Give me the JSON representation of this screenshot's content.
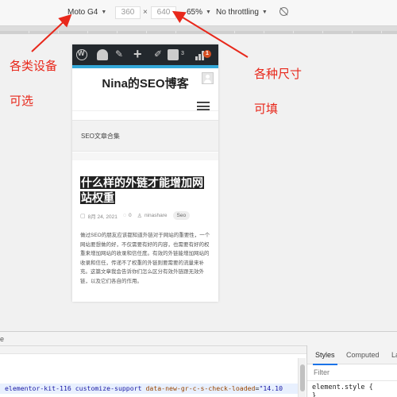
{
  "device_toolbar": {
    "device": "Moto G4",
    "width": "360",
    "times": "×",
    "height": "640",
    "zoom": "65%",
    "throttling": "No throttling",
    "dropdown_glyph": "▼",
    "rotate_icon": "rotate-icon"
  },
  "site": {
    "admin_bar": {
      "yoast_count": "3",
      "notification_count": "1",
      "icons": [
        "wordpress-icon",
        "dashboard-icon",
        "customize-icon",
        "add-new-icon",
        "edit-icon",
        "yoast-icon",
        "stats-icon"
      ]
    },
    "title": "Nina的SEO博客",
    "category_label": "SEO文章合集",
    "post": {
      "title": "什么样的外链才能增加网站权重",
      "date": "8月 24, 2021",
      "comments": "0",
      "author": "ninashare",
      "tag": "Seo",
      "excerpt": "做过SEO的朋友应该都知道外链对于网站的重要性，一个网站要想做的好，不仅需要有好的内容，也需要有好的权重来增加网站的收录和信任度。有效的外链能增加网站的收录和信任，传递不了权重的外链则要需要的流量来补充。这篇文章我会告诉你们怎么区分有效外链跟无效外链，以及它们各自的作用。"
    }
  },
  "annotations": {
    "left_top": "各类设备",
    "left_bottom": "可选",
    "right_top": "各种尺寸",
    "right_bottom": "可填",
    "color": "#e8281b"
  },
  "devtools": {
    "left_tab_label": "e",
    "code": {
      "class_value": "elementor-kit-116 customize-support",
      "attr_name": "data-new-gr-c-s-check-loaded",
      "attr_value": "\"14.10"
    },
    "tabs": [
      "Styles",
      "Computed",
      "La"
    ],
    "filter_placeholder": "Filter",
    "style_rule": "element.style {",
    "style_close": "}"
  }
}
